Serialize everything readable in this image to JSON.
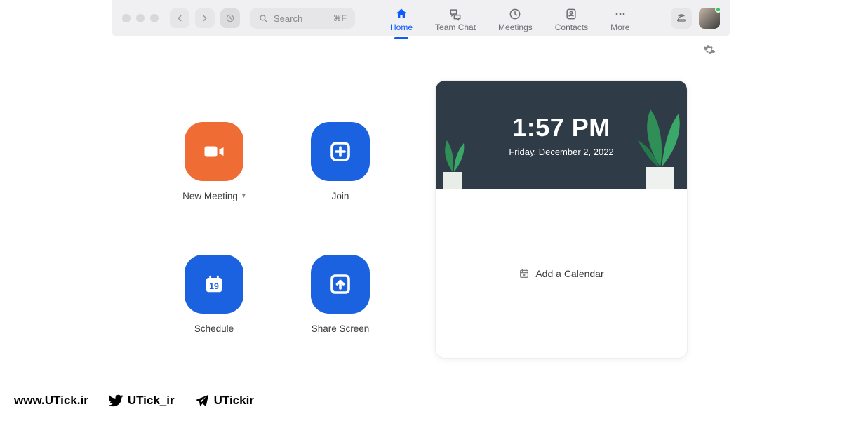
{
  "toolbar": {
    "search_placeholder": "Search",
    "search_shortcut": "⌘F"
  },
  "tabs": {
    "home": "Home",
    "teamchat": "Team Chat",
    "meetings": "Meetings",
    "contacts": "Contacts",
    "more": "More"
  },
  "actions": {
    "new_meeting": "New Meeting",
    "join": "Join",
    "schedule": "Schedule",
    "schedule_day": "19",
    "share_screen": "Share Screen"
  },
  "calendar": {
    "time": "1:57 PM",
    "date": "Friday, December 2, 2022",
    "add": "Add a Calendar"
  },
  "footer": {
    "site": "www.UTick.ir",
    "twitter": "UTick_ir",
    "telegram": "UTickir"
  }
}
